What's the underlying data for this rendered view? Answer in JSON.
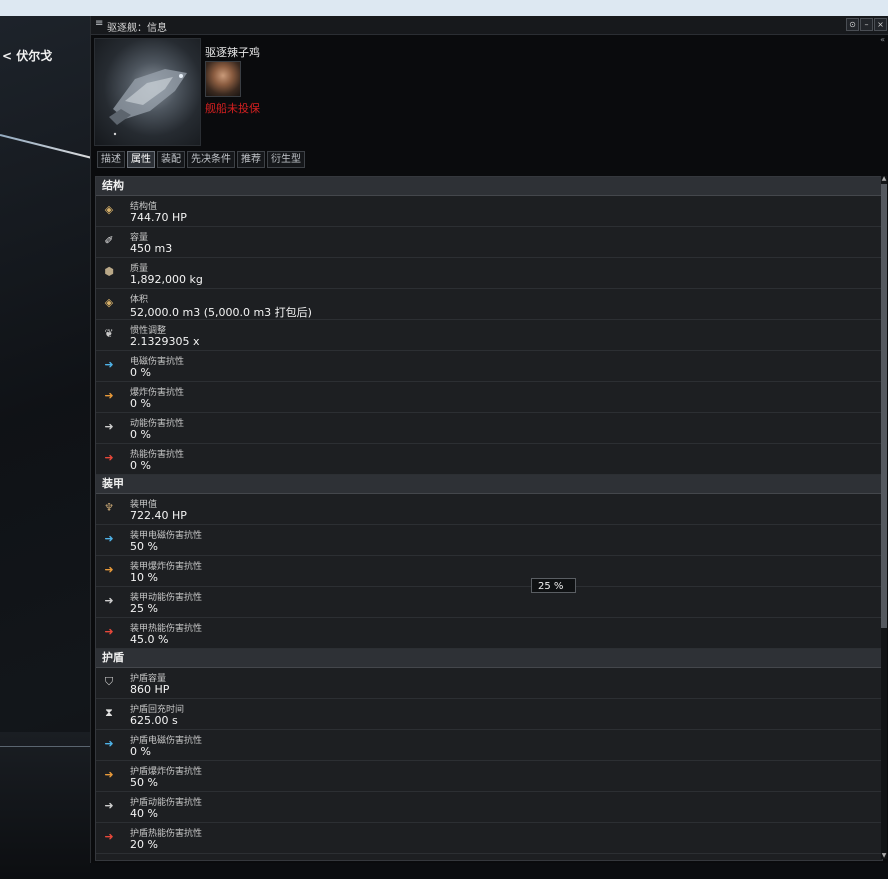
{
  "nav": {
    "back_label": "< 伏尔戈"
  },
  "window": {
    "title": "驱逐舰：信息",
    "controls": [
      "⊙",
      "–",
      "×"
    ]
  },
  "ship": {
    "name": "驱逐辣子鸡",
    "insurance_status": "舰船未投保"
  },
  "tabs": [
    {
      "label": "描述",
      "active": false
    },
    {
      "label": "属性",
      "active": true
    },
    {
      "label": "装配",
      "active": false
    },
    {
      "label": "先决条件",
      "active": false
    },
    {
      "label": "推荐",
      "active": false
    },
    {
      "label": "衍生型",
      "active": false
    }
  ],
  "sections": {
    "structure": {
      "title": "结构",
      "rows": [
        {
          "icon": "structure-hp-icon",
          "glyph": "◈",
          "label": "结构值",
          "value": "744.70 HP"
        },
        {
          "icon": "capacity-icon",
          "glyph": "✐",
          "label": "容量",
          "value": "450 m3"
        },
        {
          "icon": "mass-icon",
          "glyph": "⬢",
          "label": "质量",
          "value": "1,892,000 kg"
        },
        {
          "icon": "volume-icon",
          "glyph": "◈",
          "label": "体积",
          "value": "52,000.0 m3 (5,000.0 m3 打包后)"
        },
        {
          "icon": "inertia-icon",
          "glyph": "❦",
          "label": "惯性调整",
          "value": "2.1329305 x"
        },
        {
          "icon": "em-resist-icon",
          "glyph": "➜",
          "label": "电磁伤害抗性",
          "value": "0 %"
        },
        {
          "icon": "explosive-resist-icon",
          "glyph": "➜",
          "label": "爆炸伤害抗性",
          "value": "0 %"
        },
        {
          "icon": "kinetic-resist-icon",
          "glyph": "➜",
          "label": "动能伤害抗性",
          "value": "0 %"
        },
        {
          "icon": "thermal-resist-icon",
          "glyph": "➜",
          "label": "热能伤害抗性",
          "value": "0 %"
        }
      ]
    },
    "armor": {
      "title": "装甲",
      "rows": [
        {
          "icon": "armor-hp-icon",
          "glyph": "♆",
          "label": "装甲值",
          "value": "722.40 HP"
        },
        {
          "icon": "armor-em-resist-icon",
          "glyph": "➜",
          "label": "装甲电磁伤害抗性",
          "value": "50 %"
        },
        {
          "icon": "armor-explosive-resist-icon",
          "glyph": "➜",
          "label": "装甲爆炸伤害抗性",
          "value": "10 %"
        },
        {
          "icon": "armor-kinetic-resist-icon",
          "glyph": "➜",
          "label": "装甲动能伤害抗性",
          "value": "25 %"
        },
        {
          "icon": "armor-thermal-resist-icon",
          "glyph": "➜",
          "label": "装甲热能伤害抗性",
          "value": "45.0 %"
        }
      ]
    },
    "shield": {
      "title": "护盾",
      "rows": [
        {
          "icon": "shield-capacity-icon",
          "glyph": "⛉",
          "label": "护盾容量",
          "value": "860 HP"
        },
        {
          "icon": "shield-recharge-icon",
          "glyph": "⧗",
          "label": "护盾回充时间",
          "value": "625.00 s"
        },
        {
          "icon": "shield-em-resist-icon",
          "glyph": "➜",
          "label": "护盾电磁伤害抗性",
          "value": "0 %"
        },
        {
          "icon": "shield-explosive-resist-icon",
          "glyph": "➜",
          "label": "护盾爆炸伤害抗性",
          "value": "50 %"
        },
        {
          "icon": "shield-kinetic-resist-icon",
          "glyph": "➜",
          "label": "护盾动能伤害抗性",
          "value": "40 %"
        },
        {
          "icon": "shield-thermal-resist-icon",
          "glyph": "➜",
          "label": "护盾热能伤害抗性",
          "value": "20 %"
        }
      ]
    }
  },
  "tooltip": {
    "text": "25 %"
  },
  "colors": {
    "insurance_red": "#d42020",
    "em": "#4fb3e8",
    "explosive": "#e89a3a",
    "kinetic": "#cfcfcf",
    "thermal": "#e8483a"
  }
}
